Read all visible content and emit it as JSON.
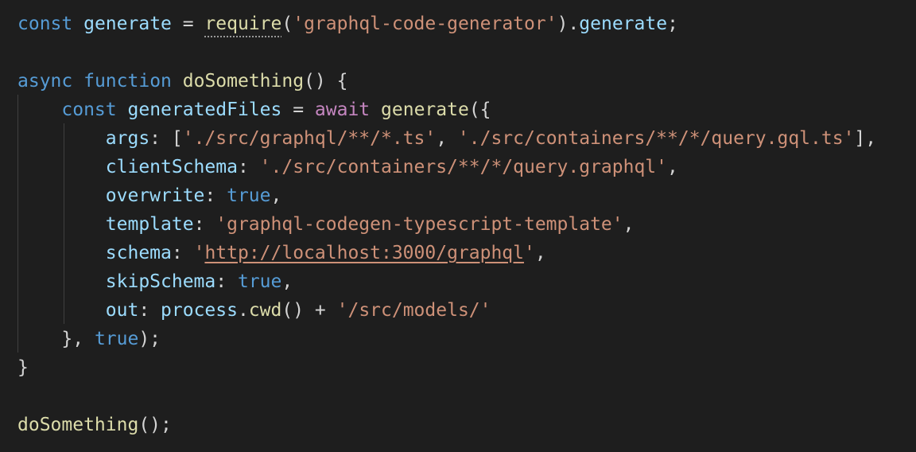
{
  "editor": {
    "lines": [
      {
        "tokens": [
          {
            "text": "const",
            "kind": "keyword"
          },
          {
            "text": " ",
            "kind": "punct"
          },
          {
            "text": "generate",
            "kind": "variable"
          },
          {
            "text": " = ",
            "kind": "punct"
          },
          {
            "text": "require",
            "kind": "function",
            "hint": true
          },
          {
            "text": "(",
            "kind": "punct"
          },
          {
            "text": "'graphql-code-generator'",
            "kind": "string"
          },
          {
            "text": ").",
            "kind": "punct"
          },
          {
            "text": "generate",
            "kind": "variable"
          },
          {
            "text": ";",
            "kind": "punct"
          }
        ]
      },
      {
        "tokens": []
      },
      {
        "tokens": [
          {
            "text": "async",
            "kind": "keyword"
          },
          {
            "text": " ",
            "kind": "punct"
          },
          {
            "text": "function",
            "kind": "keyword"
          },
          {
            "text": " ",
            "kind": "punct"
          },
          {
            "text": "doSomething",
            "kind": "function"
          },
          {
            "text": "() {",
            "kind": "punct"
          }
        ]
      },
      {
        "tokens": [
          {
            "text": "    ",
            "kind": "punct"
          },
          {
            "text": "const",
            "kind": "keyword"
          },
          {
            "text": " ",
            "kind": "punct"
          },
          {
            "text": "generatedFiles",
            "kind": "variable"
          },
          {
            "text": " = ",
            "kind": "punct"
          },
          {
            "text": "await",
            "kind": "control"
          },
          {
            "text": " ",
            "kind": "punct"
          },
          {
            "text": "generate",
            "kind": "function"
          },
          {
            "text": "({",
            "kind": "punct"
          }
        ]
      },
      {
        "tokens": [
          {
            "text": "        ",
            "kind": "punct"
          },
          {
            "text": "args",
            "kind": "variable"
          },
          {
            "text": ": [",
            "kind": "punct"
          },
          {
            "text": "'./src/graphql/**/*.ts'",
            "kind": "string"
          },
          {
            "text": ", ",
            "kind": "punct"
          },
          {
            "text": "'./src/containers/**/*/query.gql.ts'",
            "kind": "string"
          },
          {
            "text": "],",
            "kind": "punct"
          }
        ]
      },
      {
        "tokens": [
          {
            "text": "        ",
            "kind": "punct"
          },
          {
            "text": "clientSchema",
            "kind": "variable"
          },
          {
            "text": ": ",
            "kind": "punct"
          },
          {
            "text": "'./src/containers/**/*/query.graphql'",
            "kind": "string"
          },
          {
            "text": ",",
            "kind": "punct"
          }
        ]
      },
      {
        "tokens": [
          {
            "text": "        ",
            "kind": "punct"
          },
          {
            "text": "overwrite",
            "kind": "variable"
          },
          {
            "text": ": ",
            "kind": "punct"
          },
          {
            "text": "true",
            "kind": "keyword"
          },
          {
            "text": ",",
            "kind": "punct"
          }
        ]
      },
      {
        "tokens": [
          {
            "text": "        ",
            "kind": "punct"
          },
          {
            "text": "template",
            "kind": "variable"
          },
          {
            "text": ": ",
            "kind": "punct"
          },
          {
            "text": "'graphql-codegen-typescript-template'",
            "kind": "string"
          },
          {
            "text": ",",
            "kind": "punct"
          }
        ]
      },
      {
        "tokens": [
          {
            "text": "        ",
            "kind": "punct"
          },
          {
            "text": "schema",
            "kind": "variable"
          },
          {
            "text": ": ",
            "kind": "punct"
          },
          {
            "text": "'",
            "kind": "string"
          },
          {
            "text": "http://localhost:3000/graphql",
            "kind": "string",
            "link": true
          },
          {
            "text": "'",
            "kind": "string"
          },
          {
            "text": ",",
            "kind": "punct"
          }
        ]
      },
      {
        "tokens": [
          {
            "text": "        ",
            "kind": "punct"
          },
          {
            "text": "skipSchema",
            "kind": "variable"
          },
          {
            "text": ": ",
            "kind": "punct"
          },
          {
            "text": "true",
            "kind": "keyword"
          },
          {
            "text": ",",
            "kind": "punct"
          }
        ]
      },
      {
        "tokens": [
          {
            "text": "        ",
            "kind": "punct"
          },
          {
            "text": "out",
            "kind": "variable"
          },
          {
            "text": ": ",
            "kind": "punct"
          },
          {
            "text": "process",
            "kind": "variable"
          },
          {
            "text": ".",
            "kind": "punct"
          },
          {
            "text": "cwd",
            "kind": "function"
          },
          {
            "text": "() + ",
            "kind": "punct"
          },
          {
            "text": "'/src/models/'",
            "kind": "string"
          }
        ]
      },
      {
        "tokens": [
          {
            "text": "    ",
            "kind": "punct"
          },
          {
            "text": "}, ",
            "kind": "punct"
          },
          {
            "text": "true",
            "kind": "keyword"
          },
          {
            "text": ");",
            "kind": "punct"
          }
        ]
      },
      {
        "tokens": [
          {
            "text": "}",
            "kind": "punct"
          }
        ]
      },
      {
        "tokens": []
      },
      {
        "tokens": [
          {
            "text": "doSomething",
            "kind": "function"
          },
          {
            "text": "();",
            "kind": "punct"
          }
        ]
      }
    ]
  },
  "colors": {
    "background": "#1e1e1e",
    "keyword": "#569cd6",
    "control": "#c586c0",
    "function": "#dcdcaa",
    "variable": "#9cdcfe",
    "string": "#ce9178",
    "punctuation": "#d4d4d4",
    "indent_guide": "#404040"
  }
}
